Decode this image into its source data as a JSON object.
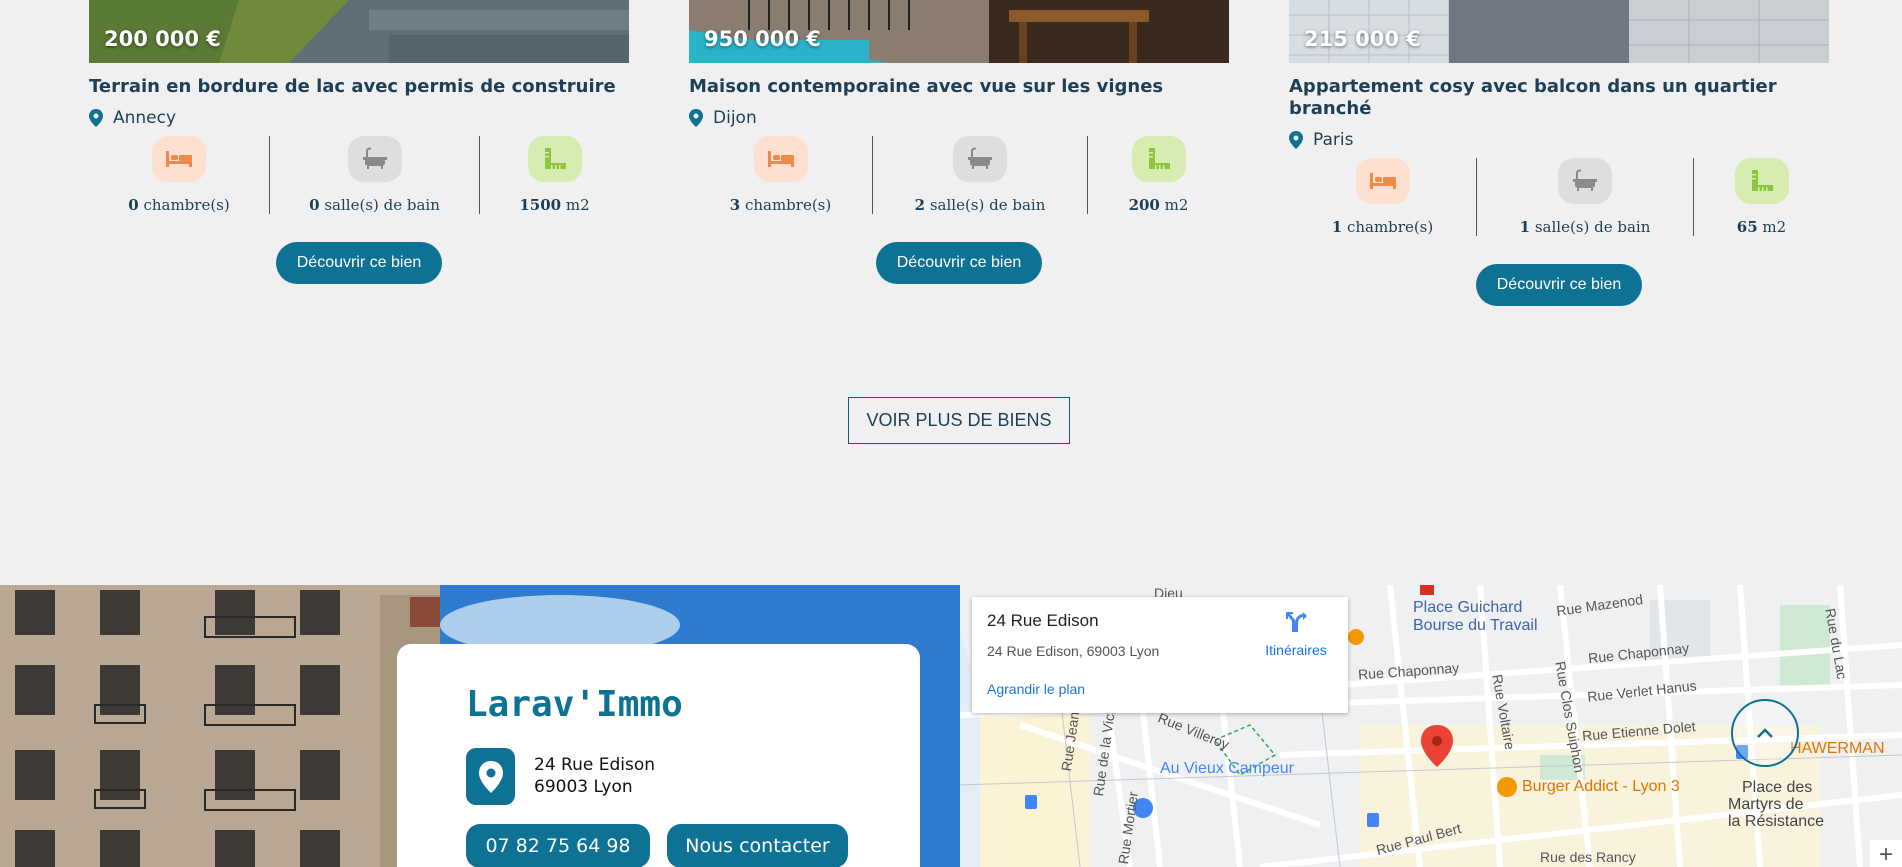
{
  "listings": [
    {
      "price": "200 000 €",
      "title": "Terrain en bordure de lac avec permis de construire",
      "city": "Annecy",
      "bedrooms_value": "0",
      "bedrooms_label": " chambre(s)",
      "bathrooms_value": "0",
      "bathrooms_label": " salle(s) de bain",
      "area_value": "1500",
      "area_label": " m2",
      "cta": "Découvrir ce bien"
    },
    {
      "price": "950 000 €",
      "title": "Maison contemporaine avec vue sur les vignes",
      "city": "Dijon",
      "bedrooms_value": "3",
      "bedrooms_label": " chambre(s)",
      "bathrooms_value": "2",
      "bathrooms_label": " salle(s) de bain",
      "area_value": "200",
      "area_label": " m2",
      "cta": "Découvrir ce bien"
    },
    {
      "price": "215 000 €",
      "title": "Appartement cosy avec balcon dans un quartier branché",
      "city": "Paris",
      "bedrooms_value": "1",
      "bedrooms_label": " chambre(s)",
      "bathrooms_value": "1",
      "bathrooms_label": " salle(s) de bain",
      "area_value": "65",
      "area_label": " m2",
      "cta": "Découvrir ce bien"
    }
  ],
  "more_button": "VOIR PLUS DE BIENS",
  "agency": {
    "name": "Larav'Immo",
    "address_line1": "24 Rue Edison",
    "address_line2": "69003 Lyon",
    "phone": "07 82 75 64 98",
    "contact_label": "Nous contacter"
  },
  "map": {
    "place_title": "24 Rue Edison",
    "place_address": "24 Rue Edison, 69003 Lyon",
    "enlarge_link": "Agrandir le plan",
    "directions_label": "Itinéraires",
    "streets": [
      "Place Guichard",
      "Bourse du Travail",
      "Rue Mazenod",
      "Rue du Lac",
      "Rue Chaponnay",
      "Rue Chaponnay",
      "Rue Voltaire",
      "Rue Clos Suiphon",
      "Rue Verlet Hanus",
      "Rue Etienne Dolet",
      "Rue Villeroy",
      "Rue Jean Larrivé",
      "Rue de la Victoire",
      "Rue Mortier",
      "Rue Paul Bert",
      "Rue des Rancy",
      "Place des",
      "Martyrs de",
      "la Résistance",
      "Dieu"
    ],
    "pois": [
      "Au Vieux Campeur",
      "Burger Addict - Lyon 3",
      "HAWERMAN"
    ],
    "zoom_in": "+"
  },
  "colors": {
    "accent": "#0e7294",
    "title": "#1e3f55",
    "bed_bg": "#fde0cf",
    "bed_fg": "#f08a4b",
    "bath_bg": "#dedede",
    "bath_fg": "#8a8a8a",
    "area_bg": "#d6ecb0",
    "area_fg": "#8cc63f"
  }
}
